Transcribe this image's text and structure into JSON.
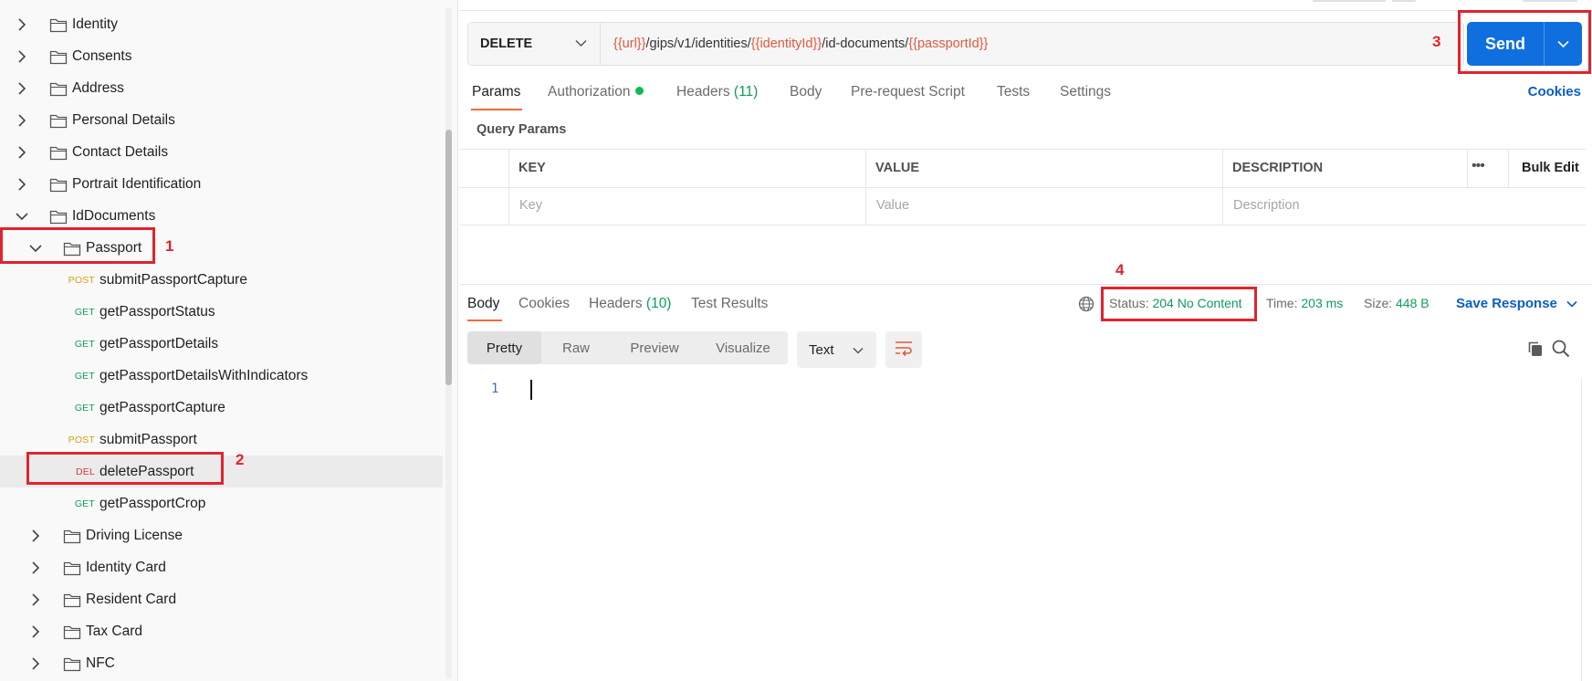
{
  "sidebar": {
    "collections": [
      {
        "label": "Identity",
        "expanded": false
      },
      {
        "label": "Consents",
        "expanded": false
      },
      {
        "label": "Address",
        "expanded": false
      },
      {
        "label": "Personal Details",
        "expanded": false
      },
      {
        "label": "Contact Details",
        "expanded": false
      },
      {
        "label": "Portrait Identification",
        "expanded": false
      },
      {
        "label": "IdDocuments",
        "expanded": true
      }
    ],
    "passport_folder": {
      "label": "Passport",
      "expanded": true
    },
    "requests": [
      {
        "method": "POST",
        "label": "submitPassportCapture"
      },
      {
        "method": "GET",
        "label": "getPassportStatus"
      },
      {
        "method": "GET",
        "label": "getPassportDetails"
      },
      {
        "method": "GET",
        "label": "getPassportDetailsWithIndicators"
      },
      {
        "method": "GET",
        "label": "getPassportCapture"
      },
      {
        "method": "POST",
        "label": "submitPassport"
      },
      {
        "method": "DEL",
        "label": "deletePassport",
        "selected": true
      },
      {
        "method": "GET",
        "label": "getPassportCrop"
      }
    ],
    "subfolders": [
      {
        "label": "Driving License"
      },
      {
        "label": "Identity Card"
      },
      {
        "label": "Resident Card"
      },
      {
        "label": "Tax Card"
      },
      {
        "label": "NFC"
      }
    ]
  },
  "request": {
    "method": "DELETE",
    "url_parts": [
      {
        "text": "{{url}}",
        "var": true
      },
      {
        "text": "/gips/v1/identities/",
        "var": false
      },
      {
        "text": "{{identityId}}",
        "var": true
      },
      {
        "text": "/id-documents/",
        "var": false
      },
      {
        "text": "{{passportId}}",
        "var": true
      }
    ],
    "send_label": "Send",
    "tabs": {
      "params": "Params",
      "authorization": "Authorization",
      "headers": "Headers",
      "headers_count": "(11)",
      "body": "Body",
      "pre_request": "Pre-request Script",
      "tests": "Tests",
      "settings": "Settings"
    },
    "cookies_label": "Cookies",
    "query_params_label": "Query Params",
    "table": {
      "headers": {
        "key": "KEY",
        "value": "VALUE",
        "description": "DESCRIPTION"
      },
      "placeholders": {
        "key": "Key",
        "value": "Value",
        "description": "Description"
      },
      "bulk_edit": "Bulk Edit",
      "more": "•••"
    }
  },
  "response": {
    "tabs": {
      "body": "Body",
      "cookies": "Cookies",
      "headers": "Headers",
      "headers_count": "(10)",
      "test_results": "Test Results"
    },
    "status_label": "Status:",
    "status_value": "204 No Content",
    "time_label": "Time:",
    "time_value": "203 ms",
    "size_label": "Size:",
    "size_value": "448 B",
    "save_response": "Save Response",
    "format_tabs": [
      "Pretty",
      "Raw",
      "Preview",
      "Visualize"
    ],
    "text_format": "Text",
    "line_number": "1"
  },
  "annotations": [
    "1",
    "2",
    "3",
    "4"
  ],
  "colors": {
    "accent_orange": "#f26b3a",
    "send_blue": "#0f6fde",
    "annotation_red": "#e1232e",
    "status_green": "#0f9d58"
  }
}
